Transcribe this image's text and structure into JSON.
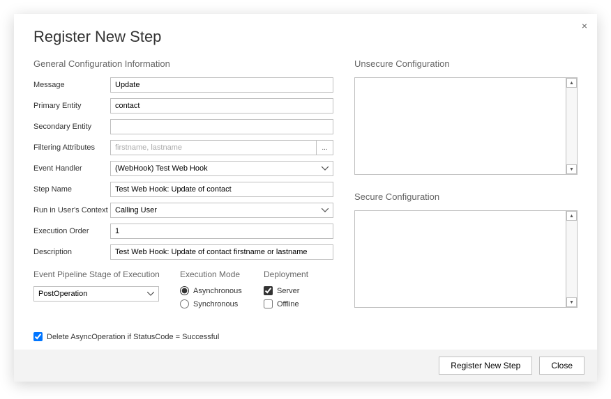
{
  "dialog": {
    "title": "Register New Step",
    "close_icon": "×"
  },
  "general": {
    "section_label": "General Configuration Information",
    "message": {
      "label": "Message",
      "value": "Update"
    },
    "primary_entity": {
      "label": "Primary Entity",
      "value": "contact"
    },
    "secondary_entity": {
      "label": "Secondary Entity",
      "value": ""
    },
    "filtering_attributes": {
      "label": "Filtering Attributes",
      "placeholder": "firstname, lastname",
      "value": "",
      "browse": "..."
    },
    "event_handler": {
      "label": "Event Handler",
      "value": "(WebHook) Test Web Hook"
    },
    "step_name": {
      "label": "Step Name",
      "value": "Test Web Hook: Update of contact"
    },
    "run_in_context": {
      "label": "Run in User's Context",
      "value": "Calling User"
    },
    "execution_order": {
      "label": "Execution Order",
      "value": "1"
    },
    "description": {
      "label": "Description",
      "value": "Test Web Hook: Update of contact firstname or lastname"
    }
  },
  "pipeline": {
    "label": "Event Pipeline Stage of Execution",
    "value": "PostOperation"
  },
  "execution_mode": {
    "label": "Execution Mode",
    "options": [
      {
        "label": "Asynchronous",
        "checked": true
      },
      {
        "label": "Synchronous",
        "checked": false
      }
    ]
  },
  "deployment": {
    "label": "Deployment",
    "options": [
      {
        "label": "Server",
        "checked": true
      },
      {
        "label": "Offline",
        "checked": false
      }
    ]
  },
  "delete_async": {
    "label": "Delete AsyncOperation if StatusCode = Successful",
    "checked": true
  },
  "unsecure": {
    "label": "Unsecure  Configuration",
    "value": ""
  },
  "secure": {
    "label": "Secure  Configuration",
    "value": ""
  },
  "footer": {
    "register": "Register New Step",
    "close": "Close"
  }
}
